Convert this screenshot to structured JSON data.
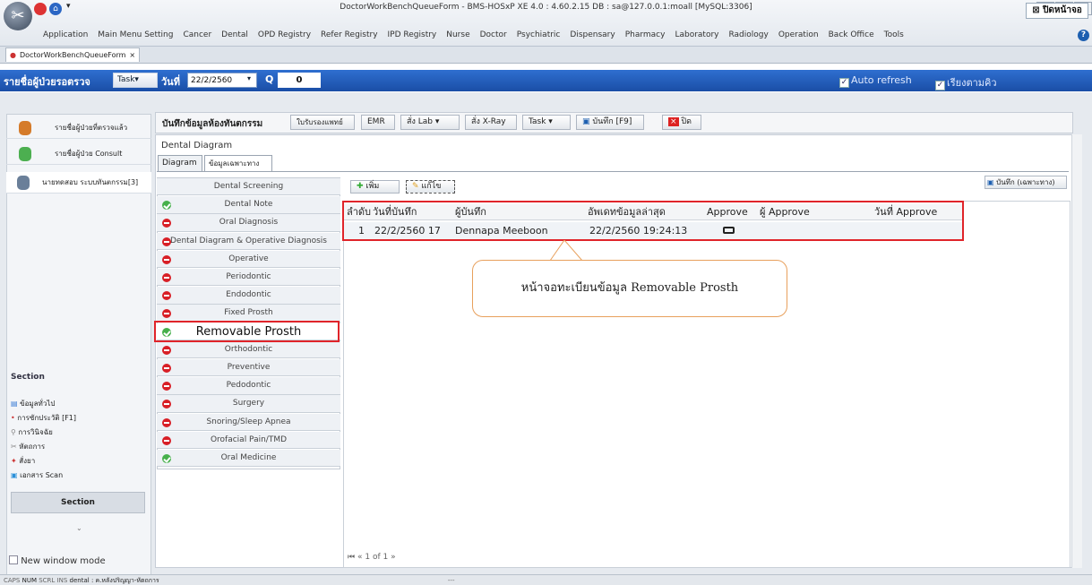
{
  "window": {
    "title": "DoctorWorkBenchQueueForm - BMS-HOSxP XE 4.0 : 4.60.2.15 DB : sa@127.0.0.1:moall [MySQL:3306]",
    "tab": "DoctorWorkBenchQueueForm",
    "controls": [
      "–",
      "▫",
      "×"
    ]
  },
  "menu": [
    "Application",
    "Main Menu Setting",
    "Cancer",
    "Dental",
    "OPD Registry",
    "Refer Registry",
    "IPD Registry",
    "Nurse",
    "Doctor",
    "Psychiatric",
    "Dispensary",
    "Pharmacy",
    "Laboratory",
    "Radiology",
    "Operation",
    "Back Office",
    "Tools"
  ],
  "toolbar": {
    "title": "รายชื่อผู้ป่วยรอตรวจ",
    "task": "Task▾",
    "date_label": "วันที่",
    "date_value": "22/2/2560",
    "q_label": "Q",
    "q_value": "0",
    "auto_refresh": "Auto refresh",
    "sort_queue": "เรียงตามคิว",
    "close": "ปิดหน้าจอ"
  },
  "left_nav": [
    {
      "label": "รายชื่อผู้ป่วยที่ตรวจแล้ว"
    },
    {
      "label": "รายชื่อผู้ป่วย Consult"
    },
    {
      "label": "นายทดสอบ ระบบทันตกรรม[3]"
    }
  ],
  "section": {
    "title": "Section",
    "items": [
      "ข้อมูลทั่วไป",
      "การซักประวัติ [F1]",
      "การวินิจฉัย",
      "หัตถการ",
      "สั่งยา",
      "เอกสาร Scan"
    ],
    "button": "Section",
    "new_window": "New window mode"
  },
  "main": {
    "title": "บันทึกข้อมูลห้องทันตกรรม",
    "buttons": [
      "ใบรับรองแพทย์",
      "EMR",
      "สั่ง Lab ▾",
      "สั่ง X-Ray",
      "Task ▾",
      "บันทึก [F9]",
      "ปิด"
    ]
  },
  "dental": {
    "heading": "Dental Diagram",
    "tabs": [
      "Diagram",
      "ข้อมูลเฉพาะทาง"
    ],
    "list": [
      {
        "label": "Dental Screening",
        "status": "none"
      },
      {
        "label": "Dental Note",
        "status": "green"
      },
      {
        "label": "Oral Diagnosis",
        "status": "red"
      },
      {
        "label": "Dental Diagram & Operative Diagnosis",
        "status": "red"
      },
      {
        "label": "Operative",
        "status": "red"
      },
      {
        "label": "Periodontic",
        "status": "red"
      },
      {
        "label": "Endodontic",
        "status": "red"
      },
      {
        "label": "Fixed Prosth",
        "status": "red"
      },
      {
        "label": "Removable Prosth",
        "status": "green"
      },
      {
        "label": "Orthodontic",
        "status": "red"
      },
      {
        "label": "Preventive",
        "status": "red"
      },
      {
        "label": "Pedodontic",
        "status": "red"
      },
      {
        "label": "Surgery",
        "status": "red"
      },
      {
        "label": "Snoring/Sleep Apnea",
        "status": "red"
      },
      {
        "label": "Orofacial Pain/TMD",
        "status": "red"
      },
      {
        "label": "Oral Medicine",
        "status": "green"
      }
    ],
    "add": "เพิ่ม",
    "edit": "แก้ไข",
    "save_special": "บันทึก (เฉพาะทาง)",
    "columns": [
      "ลำดับ",
      "วันที่บันทึก",
      "ผู้บันทึก",
      "อัพเดทข้อมูลล่าสุด",
      "Approve",
      "ผู้ Approve",
      "วันที่ Approve"
    ],
    "rows": [
      [
        "1",
        "22/2/2560 17",
        "Dennapa  Meeboon",
        "22/2/2560 19:24:13",
        "",
        "",
        ""
      ]
    ],
    "pager": "1 of 1",
    "callout": "หน้าจอทะเบียนข้อมูล Removable Prosth"
  },
  "status": {
    "caps": "CAPS",
    "num": "NUM",
    "scrl": "SCRL",
    "ins": "INS",
    "text": "dental : ค.หลังปริญญา-หัตถการ",
    "dash": "---"
  }
}
